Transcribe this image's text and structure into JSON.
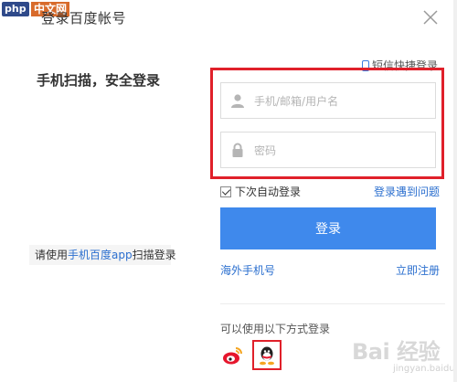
{
  "header": {
    "site_logo": "php",
    "site_logo_sub": "中文网",
    "title": "登录百度帐号",
    "close_icon": "close-icon"
  },
  "qr_login": {
    "title": "手机扫描，安全登录",
    "hint_prefix": "请使用",
    "hint_app": "手机百度app",
    "hint_suffix": "扫描登录"
  },
  "form": {
    "sms_login_label": "短信快捷登录",
    "username": {
      "placeholder": "手机/邮箱/用户名",
      "value": ""
    },
    "password": {
      "placeholder": "密码",
      "value": ""
    },
    "remember_label": "下次自动登录",
    "remember_checked": true,
    "problem_label": "登录遇到问题",
    "login_button": "登录",
    "overseas_label": "海外手机号",
    "register_label": "立即注册"
  },
  "other_login": {
    "title": "可以使用以下方式登录",
    "icons": [
      "weibo-icon",
      "qq-icon"
    ]
  },
  "watermark": {
    "text": "Bai 经验",
    "sub": "jingyan.baidu.com"
  },
  "colors": {
    "accent": "#3f89ec",
    "link": "#2b6fcf",
    "highlight": "#e0202a"
  }
}
